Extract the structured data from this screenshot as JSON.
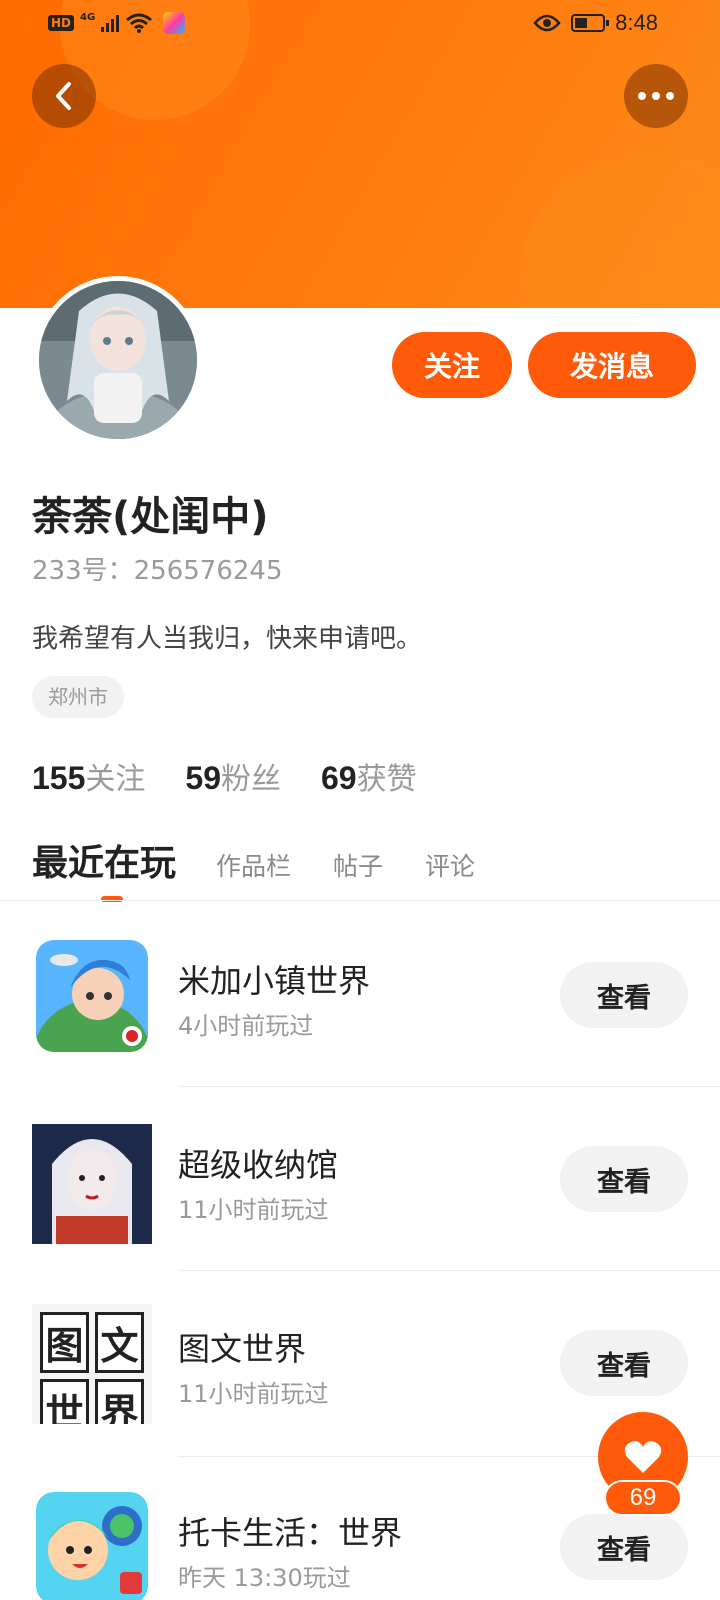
{
  "status_bar": {
    "hd_label": "HD",
    "network": "4G",
    "time": "8:48"
  },
  "profile": {
    "name": "荼荼(处闺中)",
    "id_text": "233号：256576245",
    "bio": "我希望有人当我归，快来申请吧。",
    "location": "郑州市",
    "follow_button": "关注",
    "message_button": "发消息"
  },
  "stats": [
    {
      "count": "155",
      "label": "关注"
    },
    {
      "count": "59",
      "label": "粉丝"
    },
    {
      "count": "69",
      "label": "获赞"
    }
  ],
  "tabs": [
    {
      "label": "最近在玩",
      "active": true
    },
    {
      "label": "作品栏",
      "active": false
    },
    {
      "label": "帖子",
      "active": false
    },
    {
      "label": "评论",
      "active": false
    }
  ],
  "recent_games": [
    {
      "title": "米加小镇世界",
      "played": "4小时前玩过",
      "button": "查看",
      "icon": "miga-town-icon"
    },
    {
      "title": "超级收纳馆",
      "played": "11小时前玩过",
      "button": "查看",
      "icon": "storage-hall-icon"
    },
    {
      "title": "图文世界",
      "played": "11小时前玩过",
      "button": "查看",
      "icon": "tuwen-world-icon",
      "icon_chars": [
        "图",
        "文",
        "世",
        "界"
      ]
    },
    {
      "title": "托卡生活：世界",
      "played": "昨天 13:30玩过",
      "button": "查看",
      "icon": "toca-life-icon"
    }
  ],
  "like_fab": {
    "count": "69",
    "icon": "heart-icon"
  },
  "colors": {
    "accent": "#ff5a0a",
    "header": "#ff7a10"
  }
}
